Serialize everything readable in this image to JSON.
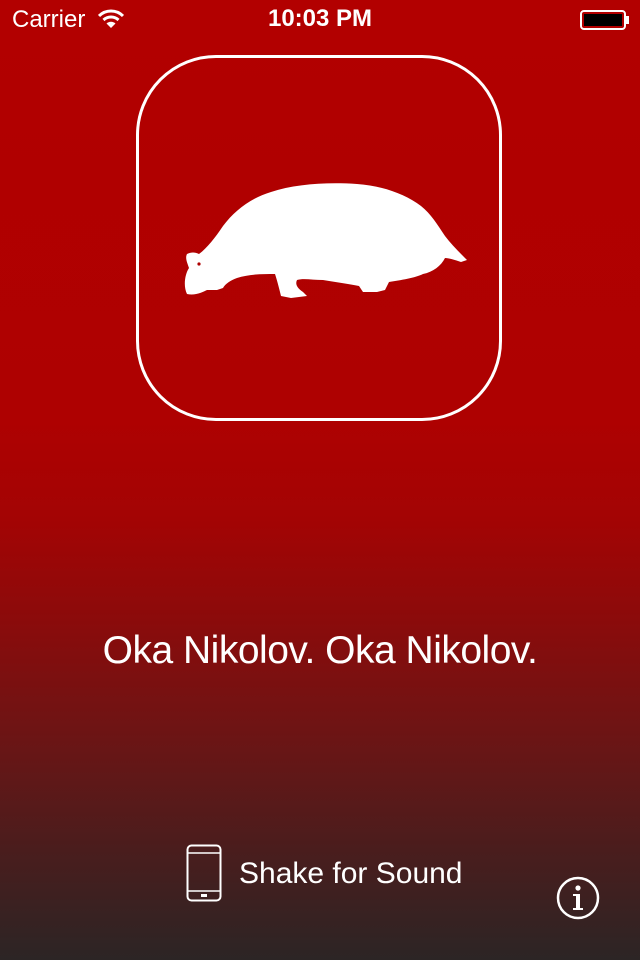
{
  "status_bar": {
    "carrier": "Carrier",
    "time": "10:03 PM",
    "icons": [
      "wifi-icon",
      "battery-icon"
    ]
  },
  "logo": {
    "icon": "badger-icon",
    "frame_color": "#ffffff"
  },
  "tagline": "Oka Nikolov. Oka Nikolov.",
  "shake": {
    "icon": "phone-icon",
    "label": "Shake for Sound"
  },
  "info": {
    "icon": "info-icon"
  },
  "colors": {
    "background_top": "#b20000",
    "background_bottom": "#2c2525",
    "foreground": "#ffffff"
  }
}
